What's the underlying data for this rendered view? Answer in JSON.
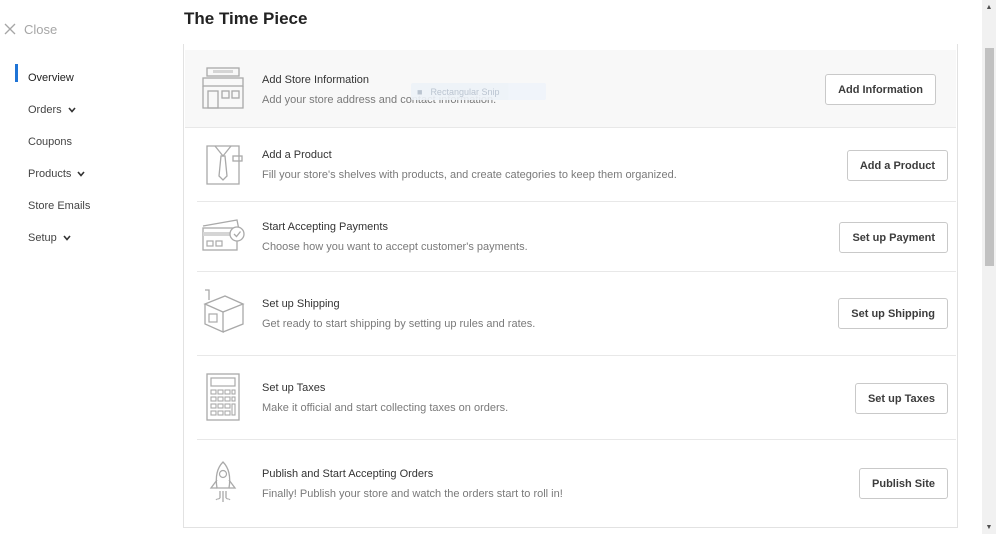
{
  "sidebar": {
    "close_label": "Close",
    "items": [
      {
        "label": "Overview",
        "has_chevron": false,
        "active": true
      },
      {
        "label": "Orders",
        "has_chevron": true,
        "active": false
      },
      {
        "label": "Coupons",
        "has_chevron": false,
        "active": false
      },
      {
        "label": "Products",
        "has_chevron": true,
        "active": false
      },
      {
        "label": "Store Emails",
        "has_chevron": false,
        "active": false
      },
      {
        "label": "Setup",
        "has_chevron": true,
        "active": false
      }
    ]
  },
  "header": {
    "title": "The Time Piece"
  },
  "tooltip_ghost": {
    "label": "Rectangular Snip"
  },
  "tasks": [
    {
      "icon": "storefront-icon",
      "title": "Add Store Information",
      "description": "Add your store address and contact information.",
      "button": "Add Information"
    },
    {
      "icon": "shirt-icon",
      "title": "Add a Product",
      "description": "Fill your store's shelves with products, and create categories to keep them organized.",
      "button": "Add a Product"
    },
    {
      "icon": "credit-card-icon",
      "title": "Start Accepting Payments",
      "description": "Choose how you want to accept customer's payments.",
      "button": "Set up Payment"
    },
    {
      "icon": "shipping-box-icon",
      "title": "Set up Shipping",
      "description": "Get ready to start shipping by setting up rules and rates.",
      "button": "Set up Shipping"
    },
    {
      "icon": "calculator-icon",
      "title": "Set up Taxes",
      "description": "Make it official and start collecting taxes on orders.",
      "button": "Set up Taxes"
    },
    {
      "icon": "rocket-icon",
      "title": "Publish and Start Accepting Orders",
      "description": "Finally! Publish your store and watch the orders start to roll in!",
      "button": "Publish Site"
    }
  ],
  "colors": {
    "accent": "#1f74d6",
    "highlight_row": "#f8f8f8",
    "icon_stroke": "#a9a9a9"
  }
}
